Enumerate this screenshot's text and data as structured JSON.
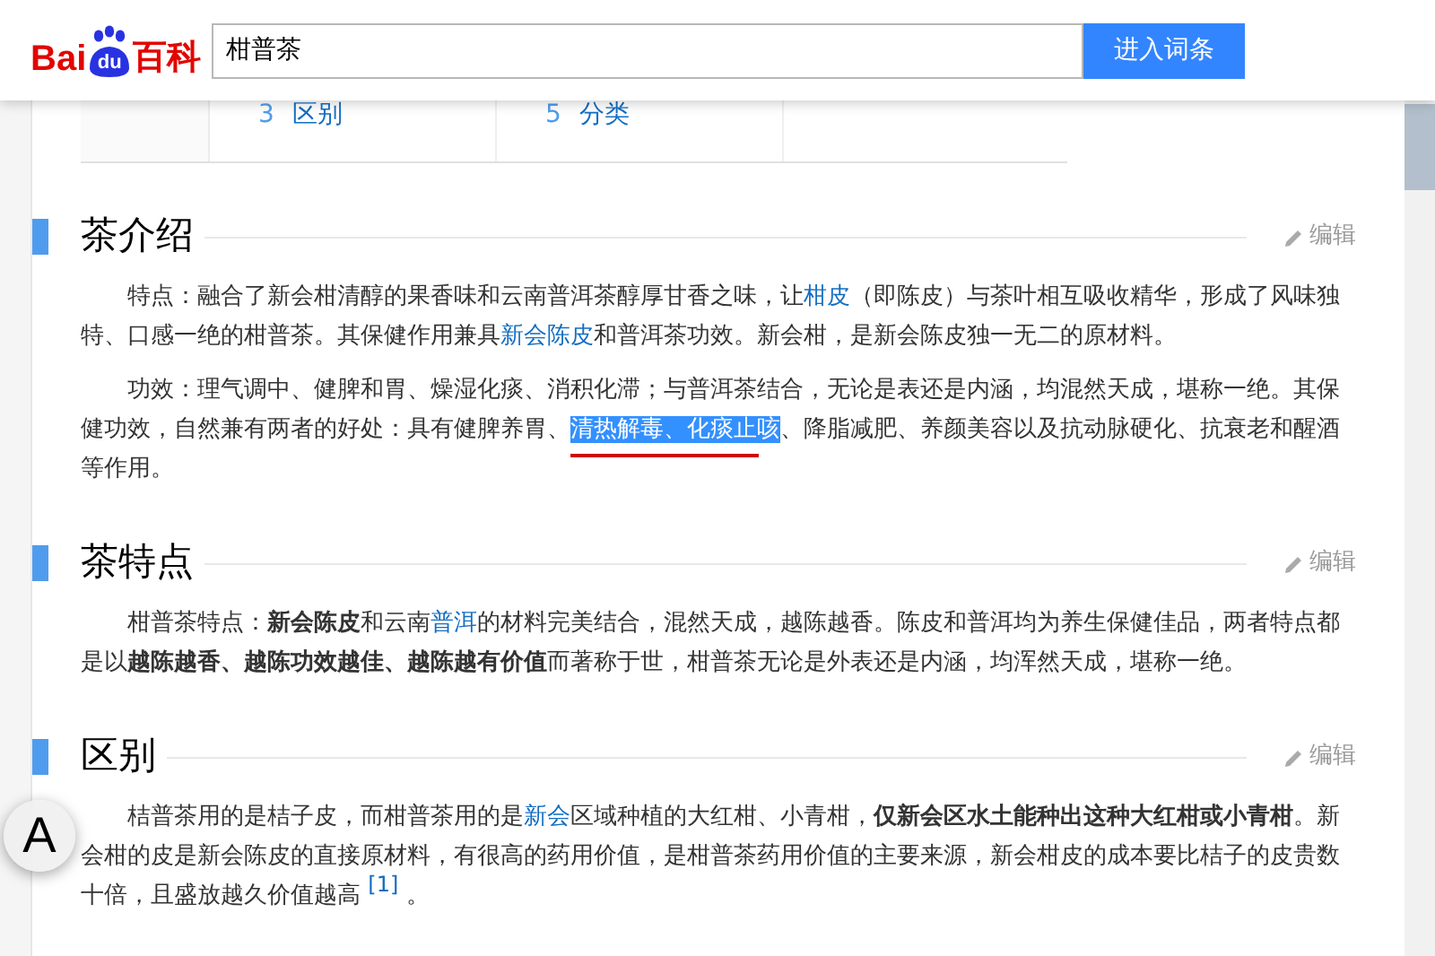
{
  "logo": {
    "part_1": "Bai",
    "part_2": "du",
    "part_3": "百科"
  },
  "search": {
    "value": "柑普茶",
    "button": "进入词条"
  },
  "toc": [
    {
      "number": "3",
      "label": "区别"
    },
    {
      "number": "5",
      "label": "分类"
    }
  ],
  "sections": [
    {
      "title": "茶介绍",
      "edit": "编辑",
      "paragraphs": [
        [
          {
            "kind": "text",
            "text": "特点：融合了新会柑清醇的果香味和云南普洱茶醇厚甘香之味，让"
          },
          {
            "kind": "link",
            "text": "柑皮"
          },
          {
            "kind": "text",
            "text": "（即陈皮）与茶叶相互吸收精华，形成了风味独特、口感一绝的柑普茶。其保健作用兼具"
          },
          {
            "kind": "link",
            "text": "新会陈皮"
          },
          {
            "kind": "text",
            "text": "和普洱茶功效。新会柑，是新会陈皮独一无二的原材料。"
          }
        ],
        [
          {
            "kind": "text",
            "text": "功效：理气调中、健脾和胃、燥湿化痰、消积化滞；与普洱茶结合，无论是表还是内涵，均混然天成，堪称一绝。其保健功效，自然兼有两者的好处：具有健脾养胃、"
          },
          {
            "kind": "selected",
            "text": "清热解毒、化痰止咳"
          },
          {
            "kind": "text",
            "text": "、降脂减肥、养颜美容以及抗动脉硬化、抗衰老和醒酒等作用。"
          }
        ]
      ]
    },
    {
      "title": "茶特点",
      "edit": "编辑",
      "paragraphs": [
        [
          {
            "kind": "text",
            "text": "柑普茶特点："
          },
          {
            "kind": "bold",
            "text": "新会陈皮"
          },
          {
            "kind": "text",
            "text": "和云南"
          },
          {
            "kind": "link",
            "text": "普洱"
          },
          {
            "kind": "text",
            "text": "的材料完美结合，混然天成，越陈越香。陈皮和普洱均为养生保健佳品，两者特点都是以"
          },
          {
            "kind": "bold",
            "text": "越陈越香、越陈功效越佳、越陈越有价值"
          },
          {
            "kind": "text",
            "text": "而著称于世，柑普茶无论是外表还是内涵，均浑然天成，堪称一绝。"
          }
        ]
      ]
    },
    {
      "title": "区别",
      "edit": "编辑",
      "paragraphs": [
        [
          {
            "kind": "text",
            "text": "桔普茶用的是桔子皮，而柑普茶用的是"
          },
          {
            "kind": "link",
            "text": "新会"
          },
          {
            "kind": "text",
            "text": "区域种植的大红柑、小青柑，"
          },
          {
            "kind": "bold",
            "text": "仅新会区水土能种出这种大红柑或小青柑"
          },
          {
            "kind": "text",
            "text": "。新会柑的皮是新会陈皮的直接原材料，有很高的药用价值，是柑普茶药用价值的主要来源，新会柑皮的成本要比桔子的皮贵数十倍，且盛放越久价值越高 "
          },
          {
            "kind": "ref",
            "text": "[1]"
          },
          {
            "kind": "text",
            "text": " 。"
          }
        ]
      ]
    }
  ],
  "font_button": "A"
}
